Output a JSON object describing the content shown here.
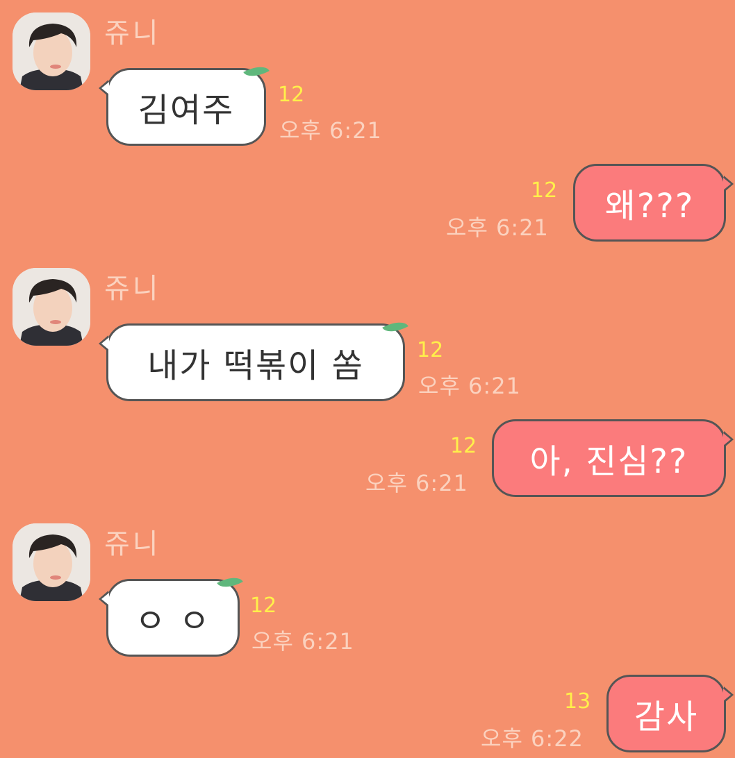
{
  "colors": {
    "background": "#f5906d",
    "incoming_bubble": "#ffffff",
    "outgoing_bubble": "#fb7b7c",
    "bubble_border": "#555555",
    "unread_count": "#fff04a",
    "timestamp": "#fbd2bf",
    "leaf_accent": "#5fb77c"
  },
  "messages": [
    {
      "sender": "쥬니",
      "text": "김여주",
      "unread": "12",
      "time": "오후 6:21",
      "direction": "incoming"
    },
    {
      "text": "왜???",
      "unread": "12",
      "time": "오후 6:21",
      "direction": "outgoing"
    },
    {
      "sender": "쥬니",
      "text": "내가 떡볶이 쏨",
      "unread": "12",
      "time": "오후 6:21",
      "direction": "incoming"
    },
    {
      "text": "아, 진심??",
      "unread": "12",
      "time": "오후 6:21",
      "direction": "outgoing"
    },
    {
      "sender": "쥬니",
      "text": "ㅇ ㅇ",
      "unread": "12",
      "time": "오후 6:21",
      "direction": "incoming"
    },
    {
      "text": "감사",
      "unread": "13",
      "time": "오후 6:22",
      "direction": "outgoing"
    }
  ]
}
